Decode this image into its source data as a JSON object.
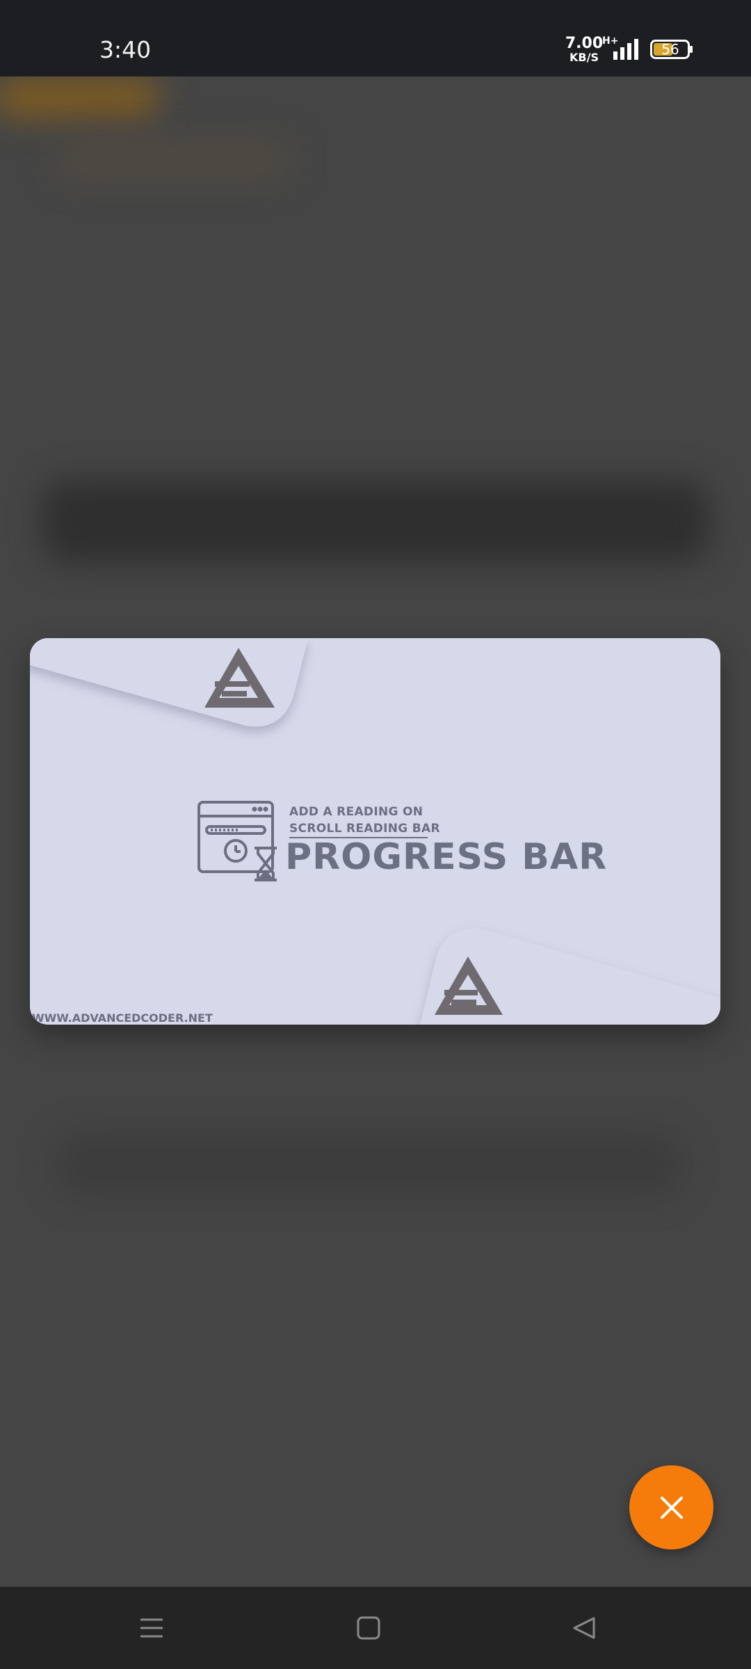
{
  "status_bar": {
    "time": "3:40",
    "net_speed_value": "7.00",
    "net_speed_unit": "KB/S",
    "network_type": "H+",
    "signal_icon": "cellular-signal-icon",
    "battery_level": "56",
    "battery_icon": "battery-icon"
  },
  "image_viewer": {
    "banner": {
      "logo_icon": "advancedcoder-logo",
      "line1": "ADD A READING ON",
      "line2": "SCROLL READING BAR",
      "title": "PROGRESS BAR",
      "url": "WWW.ADVANCEDCODER.NET",
      "illustration_icon": "browser-progress-hourglass-icon"
    },
    "close_button": {
      "icon": "close-icon",
      "color": "#f57c0b"
    }
  },
  "nav_bar": {
    "menu_icon": "menu-icon",
    "home_icon": "home-square-icon",
    "back_icon": "back-triangle-icon"
  },
  "colors": {
    "overlay": "#434343",
    "status_bar": "#1c1e21",
    "banner_bg": "#d6d9ea",
    "banner_text": "#6b7082",
    "accent": "#f57c0b"
  }
}
